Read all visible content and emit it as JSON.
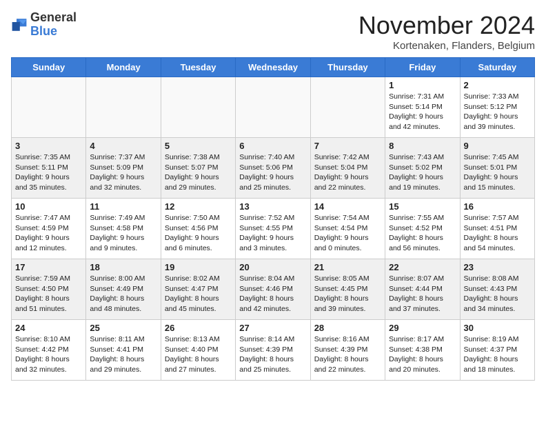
{
  "logo": {
    "general": "General",
    "blue": "Blue"
  },
  "title": "November 2024",
  "subtitle": "Kortenaken, Flanders, Belgium",
  "weekdays": [
    "Sunday",
    "Monday",
    "Tuesday",
    "Wednesday",
    "Thursday",
    "Friday",
    "Saturday"
  ],
  "weeks": [
    [
      {
        "day": "",
        "info": ""
      },
      {
        "day": "",
        "info": ""
      },
      {
        "day": "",
        "info": ""
      },
      {
        "day": "",
        "info": ""
      },
      {
        "day": "",
        "info": ""
      },
      {
        "day": "1",
        "info": "Sunrise: 7:31 AM\nSunset: 5:14 PM\nDaylight: 9 hours and 42 minutes."
      },
      {
        "day": "2",
        "info": "Sunrise: 7:33 AM\nSunset: 5:12 PM\nDaylight: 9 hours and 39 minutes."
      }
    ],
    [
      {
        "day": "3",
        "info": "Sunrise: 7:35 AM\nSunset: 5:11 PM\nDaylight: 9 hours and 35 minutes."
      },
      {
        "day": "4",
        "info": "Sunrise: 7:37 AM\nSunset: 5:09 PM\nDaylight: 9 hours and 32 minutes."
      },
      {
        "day": "5",
        "info": "Sunrise: 7:38 AM\nSunset: 5:07 PM\nDaylight: 9 hours and 29 minutes."
      },
      {
        "day": "6",
        "info": "Sunrise: 7:40 AM\nSunset: 5:06 PM\nDaylight: 9 hours and 25 minutes."
      },
      {
        "day": "7",
        "info": "Sunrise: 7:42 AM\nSunset: 5:04 PM\nDaylight: 9 hours and 22 minutes."
      },
      {
        "day": "8",
        "info": "Sunrise: 7:43 AM\nSunset: 5:02 PM\nDaylight: 9 hours and 19 minutes."
      },
      {
        "day": "9",
        "info": "Sunrise: 7:45 AM\nSunset: 5:01 PM\nDaylight: 9 hours and 15 minutes."
      }
    ],
    [
      {
        "day": "10",
        "info": "Sunrise: 7:47 AM\nSunset: 4:59 PM\nDaylight: 9 hours and 12 minutes."
      },
      {
        "day": "11",
        "info": "Sunrise: 7:49 AM\nSunset: 4:58 PM\nDaylight: 9 hours and 9 minutes."
      },
      {
        "day": "12",
        "info": "Sunrise: 7:50 AM\nSunset: 4:56 PM\nDaylight: 9 hours and 6 minutes."
      },
      {
        "day": "13",
        "info": "Sunrise: 7:52 AM\nSunset: 4:55 PM\nDaylight: 9 hours and 3 minutes."
      },
      {
        "day": "14",
        "info": "Sunrise: 7:54 AM\nSunset: 4:54 PM\nDaylight: 9 hours and 0 minutes."
      },
      {
        "day": "15",
        "info": "Sunrise: 7:55 AM\nSunset: 4:52 PM\nDaylight: 8 hours and 56 minutes."
      },
      {
        "day": "16",
        "info": "Sunrise: 7:57 AM\nSunset: 4:51 PM\nDaylight: 8 hours and 54 minutes."
      }
    ],
    [
      {
        "day": "17",
        "info": "Sunrise: 7:59 AM\nSunset: 4:50 PM\nDaylight: 8 hours and 51 minutes."
      },
      {
        "day": "18",
        "info": "Sunrise: 8:00 AM\nSunset: 4:49 PM\nDaylight: 8 hours and 48 minutes."
      },
      {
        "day": "19",
        "info": "Sunrise: 8:02 AM\nSunset: 4:47 PM\nDaylight: 8 hours and 45 minutes."
      },
      {
        "day": "20",
        "info": "Sunrise: 8:04 AM\nSunset: 4:46 PM\nDaylight: 8 hours and 42 minutes."
      },
      {
        "day": "21",
        "info": "Sunrise: 8:05 AM\nSunset: 4:45 PM\nDaylight: 8 hours and 39 minutes."
      },
      {
        "day": "22",
        "info": "Sunrise: 8:07 AM\nSunset: 4:44 PM\nDaylight: 8 hours and 37 minutes."
      },
      {
        "day": "23",
        "info": "Sunrise: 8:08 AM\nSunset: 4:43 PM\nDaylight: 8 hours and 34 minutes."
      }
    ],
    [
      {
        "day": "24",
        "info": "Sunrise: 8:10 AM\nSunset: 4:42 PM\nDaylight: 8 hours and 32 minutes."
      },
      {
        "day": "25",
        "info": "Sunrise: 8:11 AM\nSunset: 4:41 PM\nDaylight: 8 hours and 29 minutes."
      },
      {
        "day": "26",
        "info": "Sunrise: 8:13 AM\nSunset: 4:40 PM\nDaylight: 8 hours and 27 minutes."
      },
      {
        "day": "27",
        "info": "Sunrise: 8:14 AM\nSunset: 4:39 PM\nDaylight: 8 hours and 25 minutes."
      },
      {
        "day": "28",
        "info": "Sunrise: 8:16 AM\nSunset: 4:39 PM\nDaylight: 8 hours and 22 minutes."
      },
      {
        "day": "29",
        "info": "Sunrise: 8:17 AM\nSunset: 4:38 PM\nDaylight: 8 hours and 20 minutes."
      },
      {
        "day": "30",
        "info": "Sunrise: 8:19 AM\nSunset: 4:37 PM\nDaylight: 8 hours and 18 minutes."
      }
    ]
  ]
}
